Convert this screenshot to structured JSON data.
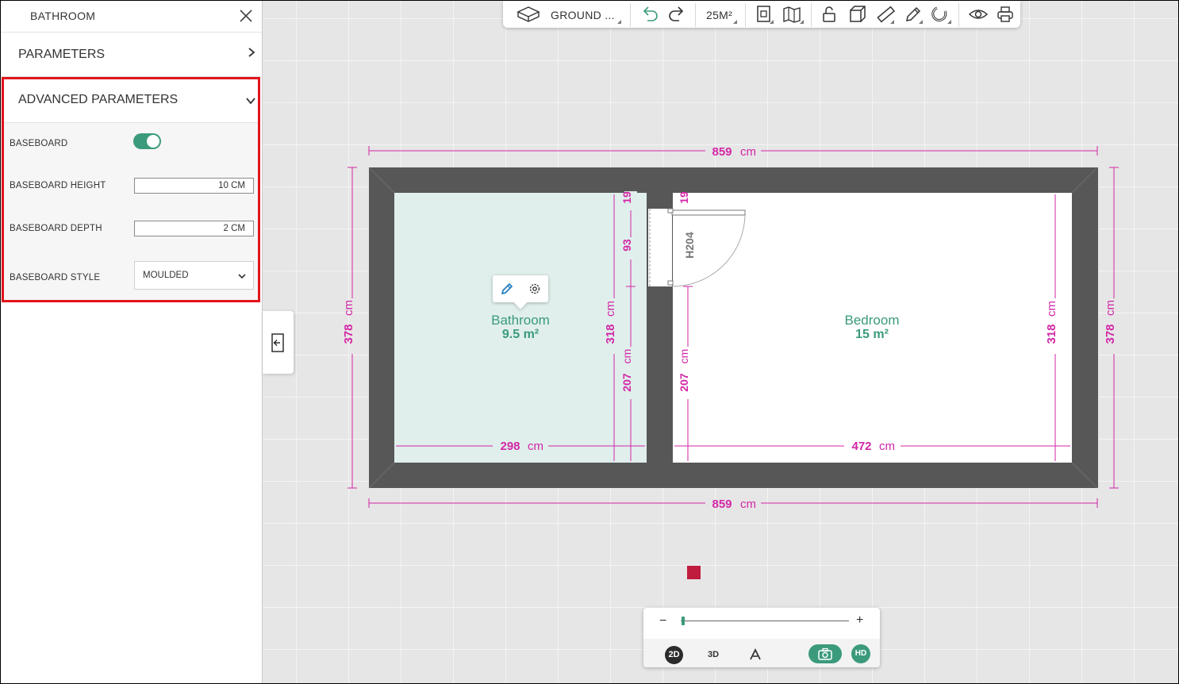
{
  "sidebar": {
    "title": "BATHROOM",
    "parameters_label": "PARAMETERS",
    "advanced_label": "ADVANCED PARAMETERS",
    "baseboard_label": "BASEBOARD",
    "baseboard_enabled": true,
    "baseboard_height_label": "BASEBOARD HEIGHT",
    "baseboard_height_value": "10  CM",
    "baseboard_depth_label": "BASEBOARD DEPTH",
    "baseboard_depth_value": "2  CM",
    "baseboard_style_label": "BASEBOARD STYLE",
    "baseboard_style_value": "MOULDED"
  },
  "toolbar": {
    "level_label": "GROUND ...",
    "area_label": "25M²",
    "icons": [
      "cube-icon",
      "undo-icon",
      "redo-icon",
      "document-icon",
      "map-icon",
      "unlock-icon",
      "box-icon",
      "ruler-icon",
      "pencil-icon",
      "magnet-icon",
      "eye-icon",
      "print-icon"
    ]
  },
  "plan": {
    "top_width": "859",
    "bottom_width": "859",
    "unit": "cm",
    "left_height": "378",
    "right_height": "378",
    "bathroom_name": "Bathroom",
    "bathroom_area": "9.5 m²",
    "bedroom_name": "Bedroom",
    "bedroom_area": "15 m²",
    "bathroom_width": "298",
    "bedroom_width": "472",
    "bathroom_height": "318",
    "bedroom_height": "318",
    "seg_top_left": "19",
    "seg_mid_left": "93",
    "seg_bottom_left": "207",
    "seg_top_right": "19",
    "seg_bottom_right": "207",
    "door_height": "H204",
    "colors": {
      "dimension": "#d326a6",
      "room_label": "#3b9a7c",
      "wall": "#575757",
      "bathroom_fill": "#e0efec"
    }
  },
  "zoom": {
    "minus": "−",
    "plus": "+",
    "mode_2d": "2D",
    "mode_3d": "3D",
    "hd": "HD"
  }
}
